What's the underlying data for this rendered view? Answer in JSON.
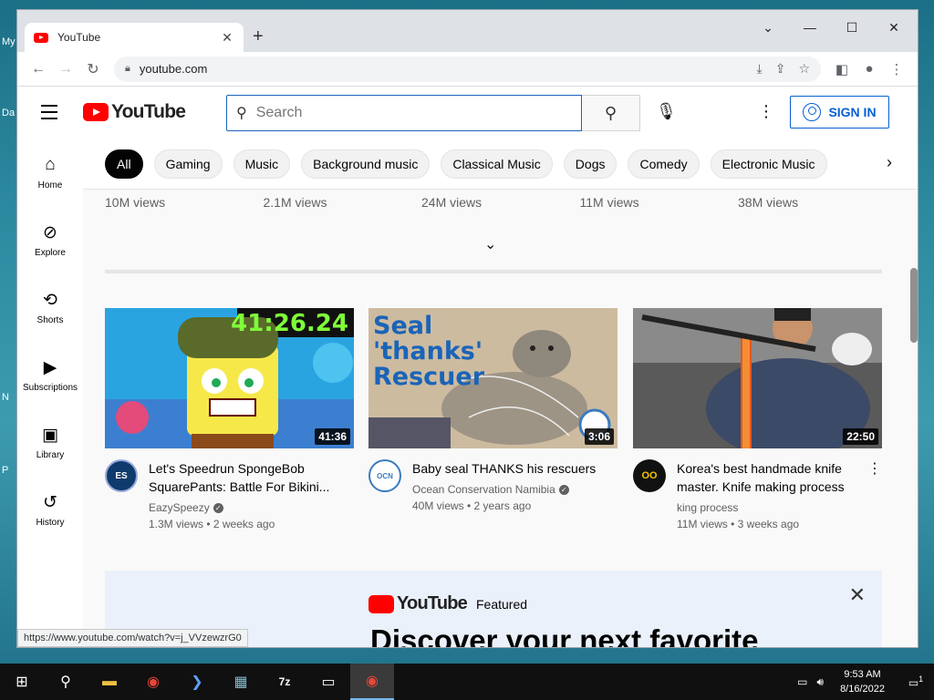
{
  "desktop": {
    "labels": [
      "My",
      "Da",
      "N",
      "P"
    ]
  },
  "browser": {
    "tab_title": "YouTube",
    "url": "youtube.com",
    "status_url": "https://www.youtube.com/watch?v=j_VVzewzrG0"
  },
  "youtube": {
    "logo_text": "YouTube",
    "search_placeholder": "Search",
    "sign_in": "SIGN IN",
    "guide": [
      {
        "label": "Home",
        "icon": "home-icon",
        "glyph": "⌂"
      },
      {
        "label": "Explore",
        "icon": "compass-icon",
        "glyph": "⊘"
      },
      {
        "label": "Shorts",
        "icon": "shorts-icon",
        "glyph": "⟲"
      },
      {
        "label": "Subscriptions",
        "icon": "subscriptions-icon",
        "glyph": "▶"
      },
      {
        "label": "Library",
        "icon": "library-icon",
        "glyph": "▣"
      },
      {
        "label": "History",
        "icon": "history-icon",
        "glyph": "↺"
      }
    ],
    "chips": [
      "All",
      "Gaming",
      "Music",
      "Background music",
      "Classical Music",
      "Dogs",
      "Comedy",
      "Electronic Music"
    ],
    "prev_row_views": [
      "10M views",
      "2.1M views",
      "24M views",
      "11M views",
      "38M views"
    ],
    "videos": [
      {
        "title": "Let's Speedrun SpongeBob SquarePants: Battle For Bikini...",
        "channel": "EazySpeezy",
        "verified": true,
        "stats": "1.3M views • 2 weeks ago",
        "duration": "41:36",
        "thumb_overlay": "41:26.24",
        "avatar_text": "ES"
      },
      {
        "title": "Baby seal THANKS his rescuers",
        "channel": "Ocean Conservation Namibia",
        "verified": true,
        "stats": "40M views • 2 years ago",
        "duration": "3:06",
        "thumb_overlay": "Seal 'thanks' Rescuer",
        "avatar_text": "OCN"
      },
      {
        "title": "Korea's best handmade knife master. Knife making process",
        "channel": "king process",
        "verified": false,
        "stats": "11M views • 3 weeks ago",
        "duration": "22:50",
        "avatar_text": "OO"
      }
    ],
    "featured": {
      "logo_text": "YouTube",
      "label": "Featured",
      "headline": "Discover your next favorite"
    }
  },
  "taskbar": {
    "time": "9:53 AM",
    "date": "8/16/2022",
    "notification_count": "1"
  }
}
